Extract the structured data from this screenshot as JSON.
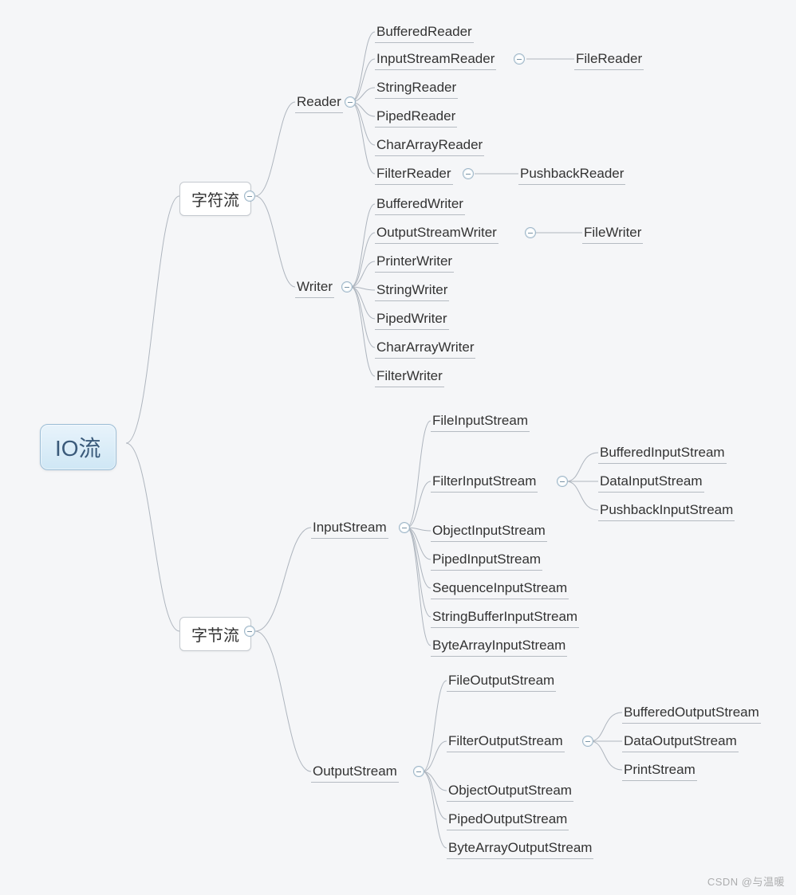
{
  "root": "IO流",
  "branches": [
    {
      "label": "字符流",
      "children": [
        {
          "label": "Reader",
          "children": [
            {
              "label": "BufferedReader"
            },
            {
              "label": "InputStreamReader",
              "children": [
                {
                  "label": "FileReader"
                }
              ]
            },
            {
              "label": "StringReader"
            },
            {
              "label": "PipedReader"
            },
            {
              "label": "CharArrayReader"
            },
            {
              "label": "FilterReader",
              "children": [
                {
                  "label": "PushbackReader"
                }
              ]
            }
          ]
        },
        {
          "label": "Writer",
          "children": [
            {
              "label": "BufferedWriter"
            },
            {
              "label": "OutputStreamWriter",
              "children": [
                {
                  "label": "FileWriter"
                }
              ]
            },
            {
              "label": "PrinterWriter"
            },
            {
              "label": "StringWriter"
            },
            {
              "label": "PipedWriter"
            },
            {
              "label": "CharArrayWriter"
            },
            {
              "label": "FilterWriter"
            }
          ]
        }
      ]
    },
    {
      "label": "字节流",
      "children": [
        {
          "label": "InputStream",
          "children": [
            {
              "label": "FileInputStream"
            },
            {
              "label": "FilterInputStream",
              "children": [
                {
                  "label": "BufferedInputStream"
                },
                {
                  "label": "DataInputStream"
                },
                {
                  "label": "PushbackInputStream"
                }
              ]
            },
            {
              "label": "ObjectInputStream"
            },
            {
              "label": "PipedInputStream"
            },
            {
              "label": "SequenceInputStream"
            },
            {
              "label": "StringBufferInputStream"
            },
            {
              "label": "ByteArrayInputStream"
            }
          ]
        },
        {
          "label": "OutputStream",
          "children": [
            {
              "label": "FileOutputStream"
            },
            {
              "label": "FilterOutputStream",
              "children": [
                {
                  "label": "BufferedOutputStream"
                },
                {
                  "label": "DataOutputStream"
                },
                {
                  "label": "PrintStream"
                }
              ]
            },
            {
              "label": "ObjectOutputStream"
            },
            {
              "label": "PipedOutputStream"
            },
            {
              "label": "ByteArrayOutputStream"
            }
          ]
        }
      ]
    }
  ],
  "watermark": "CSDN @与温暖"
}
